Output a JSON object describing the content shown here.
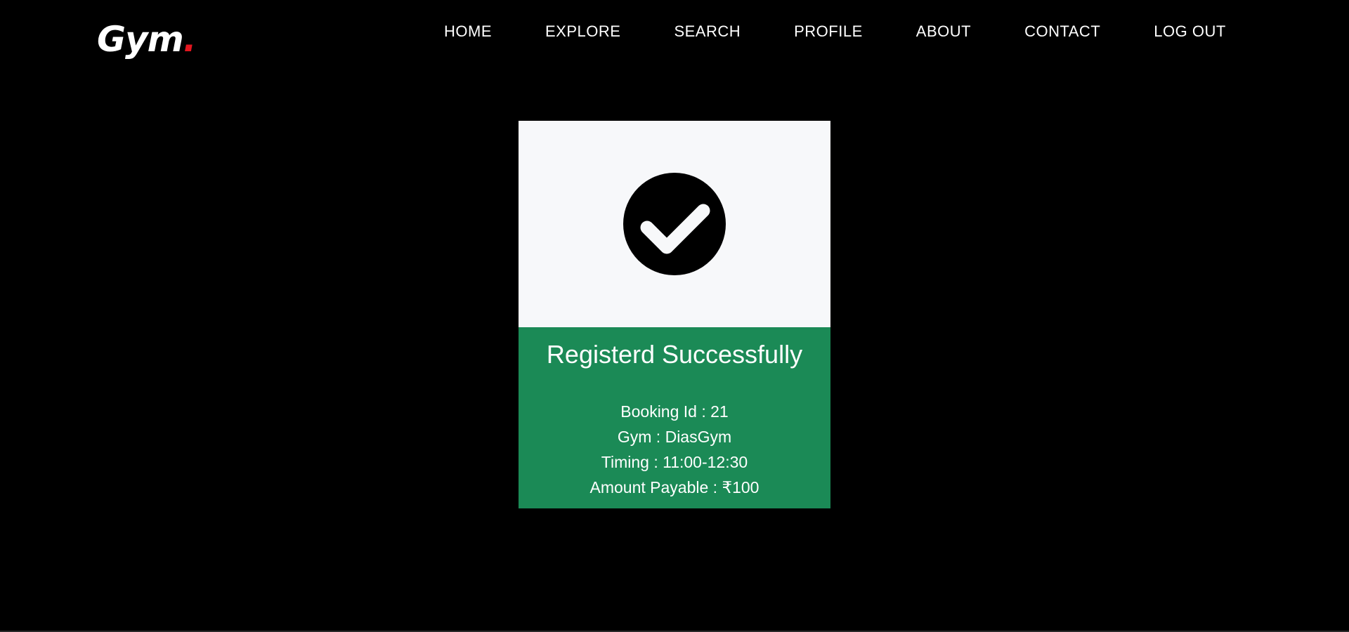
{
  "brand": {
    "logo_text": "Gym",
    "logo_dot": ".",
    "accent_color": "#e3161f"
  },
  "nav": {
    "items": [
      {
        "label": "HOME"
      },
      {
        "label": "EXPLORE"
      },
      {
        "label": "SEARCH"
      },
      {
        "label": "PROFILE"
      },
      {
        "label": "ABOUT"
      },
      {
        "label": "CONTACT"
      },
      {
        "label": "LOG OUT"
      }
    ]
  },
  "card": {
    "icon": "check-circle-icon",
    "title": "Registerd Successfully",
    "success_color": "#1b8a56",
    "details": [
      {
        "label": "Booking Id",
        "value": "21",
        "text": "Booking Id : 21"
      },
      {
        "label": "Gym",
        "value": "DiasGym",
        "text": "Gym : DiasGym"
      },
      {
        "label": "Timing",
        "value": "11:00-12:30",
        "text": "Timing : 11:00-12:30"
      },
      {
        "label": "Amount Payable",
        "value": "₹100",
        "text": "Amount Payable : ₹100"
      }
    ]
  }
}
